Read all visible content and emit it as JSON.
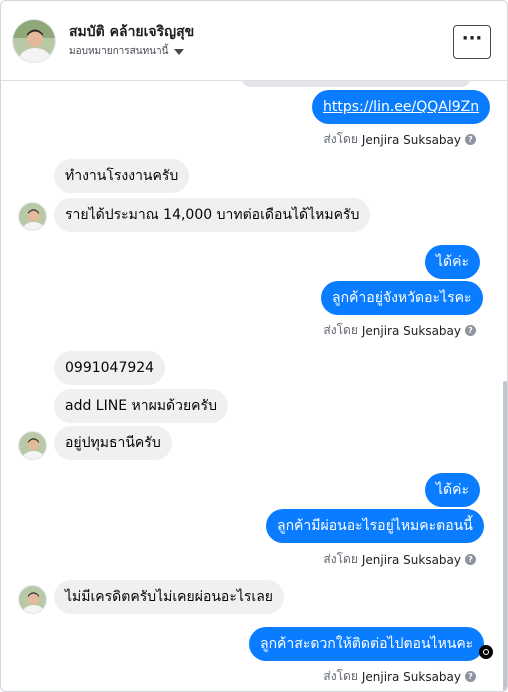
{
  "header": {
    "user_name": "สมบัติ คล้ายเจริญสุข",
    "assign_label": "มอบหมายการสนทนานี้",
    "more_label": "···"
  },
  "messages": {
    "m1": "https://lin.ee/QQAl9Zn",
    "m2": "ทำงานโรงงานครับ",
    "m3": "รายได้ประมาณ 14,000 บาทต่อเดือนได้ไหมครับ",
    "m4": "ได้ค่ะ",
    "m5": "ลูกค้าอยู่จังหวัดอะไรคะ",
    "m6": "0991047924",
    "m7": "add LINE หาผมด้วยครับ",
    "m8": "อยู่ปทุมธานีครับ",
    "m9": "ได้ค่ะ",
    "m10": "ลูกค้ามีผ่อนอะไรอยู่ไหมคะตอนนี้",
    "m11": "ไม่มีเครดิตครับไม่เคยผ่อนอะไรเลย",
    "m12": "ลูกค้าสะดวกให้ติดต่อไปตอนไหนคะ"
  },
  "sent_by": {
    "prefix": "ส่งโดย",
    "name": "Jenjira Suksabay",
    "help": "?"
  }
}
